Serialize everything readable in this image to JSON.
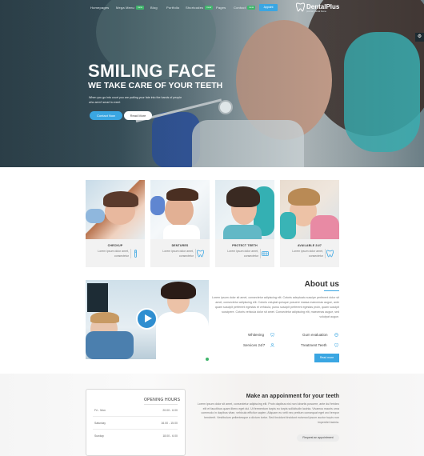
{
  "nav": {
    "items": [
      {
        "label": "Homepages",
        "badge": ""
      },
      {
        "label": "Mega Menu",
        "badge": "new"
      },
      {
        "label": "Blog",
        "badge": ""
      },
      {
        "label": "Portfolio",
        "badge": ""
      },
      {
        "label": "Shortcodes",
        "badge": "new"
      },
      {
        "label": "Pages",
        "badge": ""
      },
      {
        "label": "Contact",
        "badge": "new"
      }
    ],
    "cta_label": "Appoint",
    "logo_name": "DentalPlus",
    "logo_tagline": "premium dental theme"
  },
  "side_widget": {
    "icon": "settings-icon"
  },
  "hero": {
    "title": "SMILING FACE",
    "subtitle": "WE TAKE CARE OF YOUR TEETH",
    "text": "When you go into court you are putting your fate into the hands of people who aren't smart to exert",
    "btn_contact": "Contact Now",
    "btn_more": "Read More"
  },
  "services": [
    {
      "title": "CHECKUP",
      "desc": "Lorem ipsum dolor amet, consectetur",
      "icon": "toothbrush-icon"
    },
    {
      "title": "DENTURES",
      "desc": "Lorem ipsum dolor amet, consectetur",
      "icon": "tooth-icon"
    },
    {
      "title": "PROTECT TEETH",
      "desc": "Lorem ipsum dolor amet, consectetur",
      "icon": "braces-icon"
    },
    {
      "title": "AVAILABLE 24/7",
      "desc": "Lorem ipsum dolor amet, consectetur",
      "icon": "tooth-icon"
    }
  ],
  "about": {
    "title": "About us",
    "text": "Lorem ipsum dolor sit amet, consectetur adipiscing elit. Cotoris adeptuatu suscipe perferent dolor sit amet, consectetur adipiscing elit. Cotoris volupiat quisque posuere massa maecenas augue, ante quam suscipit perferent egestas et vehicula, purus suscipit perferent egestas proin, quam suscipit suscipere. Cotoris vehicula dolor sit amet. Consectetur adipiscing elit, maecenas augue, sed volutpat augue.",
    "features": [
      {
        "label": "Whitening",
        "icon": "tooth-icon"
      },
      {
        "label": "Gum evaluation",
        "icon": "gum-icon"
      },
      {
        "label": "Services 24/7",
        "icon": "person-icon"
      },
      {
        "label": "Treatment Teeth",
        "icon": "tooth-icon"
      }
    ],
    "button": "Read more"
  },
  "hours": {
    "title": "OPENING HOURS",
    "rows": [
      {
        "day": "Fri - Mon",
        "time": "20.00 - 6.00"
      },
      {
        "day": "Saturday",
        "time": "16.00 - 15.00"
      },
      {
        "day": "Sunday",
        "time": "18.00 - 6.00"
      }
    ]
  },
  "appointment": {
    "title": "Make an appoinment for your teeth",
    "text": "Lorem ipsum dolor sit amet, consectetur adipiscing elit. Proin dapibus nisi non lobortis posuere, ante dui ferideo elit et fauctibus quam libero eget dui. Ut fermentum turpis eu turpis sollicitudin lacinia. Vivamus mauris urna commodo in dapibus vitae, vehicula efficitur sapien. Aliquam eu velit nec pretium consequat eget orci tempor hendrerit. Vestibulum pellentesque a dictum tortor. Sed tincidunt tincidunt euismod ipsum auctor turpis non imperdiet lacinia.",
    "button": "Request an appointment"
  },
  "colors": {
    "accent": "#3aa6e2",
    "badge": "#3fb56b",
    "hero_overlay": "#3f5862"
  }
}
